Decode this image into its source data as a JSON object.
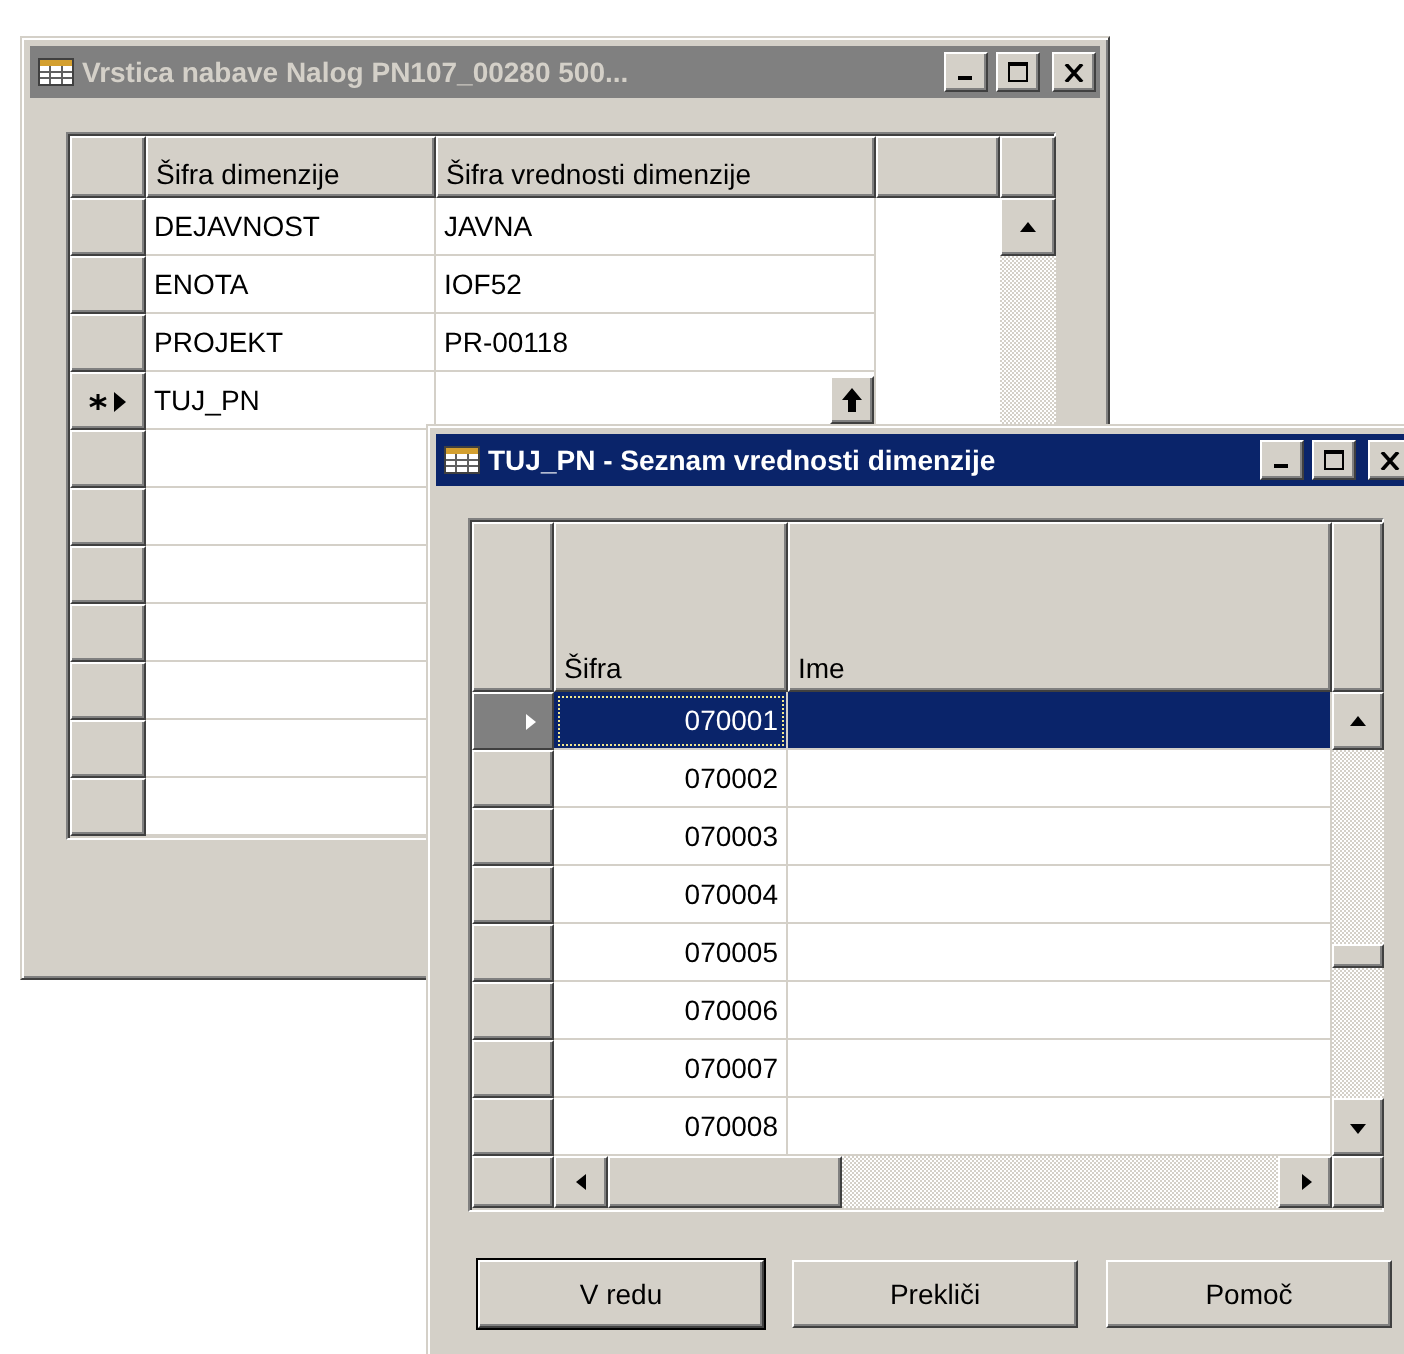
{
  "back_window": {
    "title": "Vrstica nabave Nalog PN107_00280 500...",
    "active": false,
    "table": {
      "columns": [
        "Šifra dimenzije",
        "Šifra vrednosti dimenzije"
      ],
      "rows": [
        {
          "dimension_code": "DEJAVNOST",
          "value_code": "JAVNA",
          "current": false
        },
        {
          "dimension_code": "ENOTA",
          "value_code": "IOF52",
          "current": false
        },
        {
          "dimension_code": "PROJEKT",
          "value_code": "PR-00118",
          "current": false
        },
        {
          "dimension_code": "TUJ_PN",
          "current": true
        }
      ]
    }
  },
  "front_window": {
    "title": "TUJ_PN - Seznam vrednosti dimenzije",
    "active": true,
    "table": {
      "columns": [
        "Šifra",
        "Ime"
      ],
      "rows": [
        {
          "code": "070001",
          "selected": true
        },
        {
          "code": "070002",
          "selected": false
        },
        {
          "code": "070003",
          "selected": false
        },
        {
          "code": "070004",
          "selected": false
        },
        {
          "code": "070005",
          "selected": false
        },
        {
          "code": "070006",
          "selected": false
        },
        {
          "code": "070007",
          "selected": false
        },
        {
          "code": "070008",
          "selected": false
        }
      ]
    },
    "buttons": [
      {
        "label": "V redu",
        "default": true
      },
      {
        "label": "Prekliči",
        "default": false
      },
      {
        "label": "Pomoč",
        "default": false
      }
    ]
  }
}
